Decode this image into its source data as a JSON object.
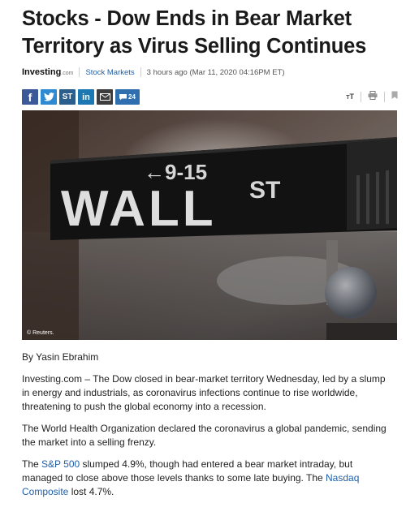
{
  "article": {
    "headline": "Stocks - Dow Ends in Bear Market Territory as Virus Selling Continues",
    "source_logo": "Investing",
    "source_logo_suffix": ".com",
    "category": "Stock Markets",
    "timestamp": "3 hours ago (Mar 11, 2020 04:16PM ET)",
    "comment_count": "24",
    "share": {
      "facebook": "f",
      "twitter": "t",
      "stocktwits": "ST",
      "linkedin": "in"
    },
    "font_size_label": "T",
    "image": {
      "sign_arrow_text": "←9-15",
      "sign_main": "WALL",
      "sign_suffix": "ST",
      "credit": "© Reuters."
    },
    "byline": "By Yasin Ebrahim",
    "paragraph_1": "Investing.com – The Dow closed in bear-market territory Wednesday, led by a slump in energy and industrials, as coronavirus infections continue to rise worldwide, threatening to push the global economy into a recession.",
    "paragraph_2": "The World Health Organization declared the coronavirus a global pandemic, sending the market into a selling frenzy.",
    "paragraph_3": {
      "before_link_1": "The ",
      "link_1": "S&P 500",
      "middle": " slumped 4.9%, though had entered a bear market intraday, but managed to close above those levels thanks to some late buying. The ",
      "link_2": "Nasdaq Composite",
      "after_link_2": " lost 4.7%."
    }
  },
  "colors": {
    "facebook": "#3b5998",
    "twitter": "#2f8ad1",
    "linkedin": "#1b78b3",
    "link": "#1f5fa8"
  }
}
